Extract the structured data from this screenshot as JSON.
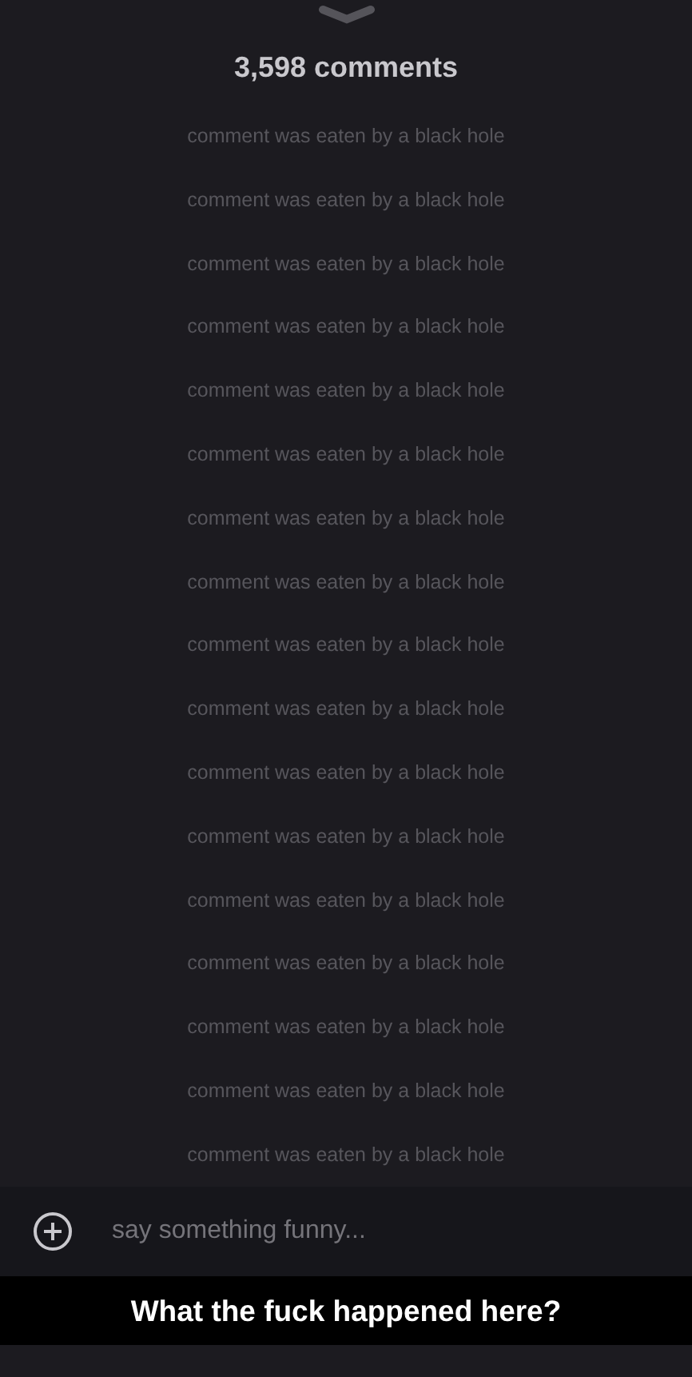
{
  "header": {
    "title": "3,598 comments"
  },
  "comments": [
    {
      "text": "comment was eaten by a black hole"
    },
    {
      "text": "comment was eaten by a black hole"
    },
    {
      "text": "comment was eaten by a black hole"
    },
    {
      "text": "comment was eaten by a black hole"
    },
    {
      "text": "comment was eaten by a black hole"
    },
    {
      "text": "comment was eaten by a black hole"
    },
    {
      "text": "comment was eaten by a black hole"
    },
    {
      "text": "comment was eaten by a black hole"
    },
    {
      "text": "comment was eaten by a black hole"
    },
    {
      "text": "comment was eaten by a black hole"
    },
    {
      "text": "comment was eaten by a black hole"
    },
    {
      "text": "comment was eaten by a black hole"
    },
    {
      "text": "comment was eaten by a black hole"
    },
    {
      "text": "comment was eaten by a black hole"
    },
    {
      "text": "comment was eaten by a black hole"
    },
    {
      "text": "comment was eaten by a black hole"
    },
    {
      "text": "comment was eaten by a black hole"
    }
  ],
  "composer": {
    "placeholder": "say something funny..."
  },
  "caption": "What the fuck happened here?"
}
